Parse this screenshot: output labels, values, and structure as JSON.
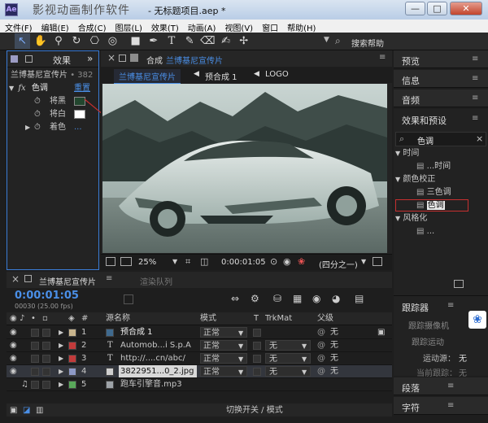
{
  "window": {
    "watermark": "影视动画制作软件",
    "title": "- 无标题项目.aep *",
    "minimize": "—",
    "maximize": "□",
    "close": "✕"
  },
  "menu": [
    "文件(F)",
    "编辑(E)",
    "合成(C)",
    "图层(L)",
    "效果(T)",
    "动画(A)",
    "视图(V)",
    "窗口",
    "帮助(H)"
  ],
  "toolbar": {
    "tools": [
      "selection-tool",
      "hand-tool",
      "zoom-tool",
      "rotate-tool",
      "camera-tool",
      "pan-behind-tool",
      "rectangle-tool",
      "pen-tool",
      "type-tool",
      "brush-tool",
      "eraser-tool",
      "roto-brush-tool",
      "puppet-tool"
    ],
    "search_help": "搜索帮助"
  },
  "effects_controls": {
    "tab_label": "效果",
    "tab_menu": "»",
    "layer_prefix": "兰博基尼宣传片",
    "layer_suffix": "• 382",
    "effect_name": "色调",
    "reset_label": "重置",
    "properties": [
      {
        "label": "将黑",
        "swatch": "#22462e"
      },
      {
        "label": "将白",
        "swatch": "#ffffff"
      },
      {
        "label": "着色",
        "value": "..."
      }
    ],
    "colors": {
      "accent": "#3a7bd5",
      "link": "#4a8fe7"
    }
  },
  "composition": {
    "tab_prefix": "合成",
    "tab_name": "兰博基尼宣传片",
    "flow": [
      "兰博基尼宣传片",
      "预合成 1",
      "LOGO"
    ],
    "zoom": "25%",
    "timecode": "0:00:01:05",
    "resolution": "(四分之一)"
  },
  "right_panels": {
    "preview": "预览",
    "info": "信息",
    "audio": "音频",
    "effects_presets": "效果和预设",
    "search_value": "色调",
    "tree": [
      {
        "type": "group",
        "label": "时间"
      },
      {
        "type": "item",
        "label": "...时间"
      },
      {
        "type": "group",
        "label": "颜色校正"
      },
      {
        "type": "item",
        "label": "三色调"
      },
      {
        "type": "item",
        "label": "色调",
        "selected": true
      },
      {
        "type": "group",
        "label": "风格化"
      },
      {
        "type": "item",
        "label": "..."
      }
    ],
    "tracker": "跟踪器",
    "track_camera": "跟踪摄像机",
    "track_motion": "跟踪运动",
    "motion_source_label": "运动源：",
    "motion_source_value": "无",
    "current_track_label": "当前跟踪：",
    "current_track_value": "无",
    "paragraph": "段落",
    "character": "字符",
    "menu": "≡"
  },
  "timeline": {
    "tab_name": "兰博基尼宣传片",
    "render_queue": "渲染队列",
    "timecode": "0:00:01:05",
    "frames": "00030 (25.00 fps)",
    "columns": {
      "num": "#",
      "source": "源名称",
      "mode": "模式",
      "t": "T",
      "trkmat": "TrkMat",
      "parent": "父级"
    },
    "layers": [
      {
        "num": "1",
        "name": "预合成 1",
        "label_color": "#c9b58e",
        "mode": "正常",
        "trkmat": "",
        "parent": "无",
        "icon": "precomp-icon"
      },
      {
        "num": "2",
        "name": "Automob...i S.p.A",
        "label_color": "#c23b3b",
        "mode": "正常",
        "trkmat": "无",
        "parent": "无",
        "icon": "text-layer-icon"
      },
      {
        "num": "3",
        "name": "http://....cn/abc/",
        "label_color": "#c23b3b",
        "mode": "正常",
        "trkmat": "无",
        "parent": "无",
        "icon": "text-layer-icon"
      },
      {
        "num": "4",
        "name": "3822951...0_2.jpg",
        "label_color": "#8d99c6",
        "mode": "正常",
        "trkmat": "无",
        "parent": "无",
        "icon": "image-layer-icon",
        "selected": true
      },
      {
        "num": "5",
        "name": "跑车引擎音.mp3",
        "label_color": "#59a85a",
        "mode": "",
        "trkmat": "",
        "parent": "",
        "icon": "audio-layer-icon"
      }
    ],
    "footer_label": "切换开关 / 模式"
  }
}
